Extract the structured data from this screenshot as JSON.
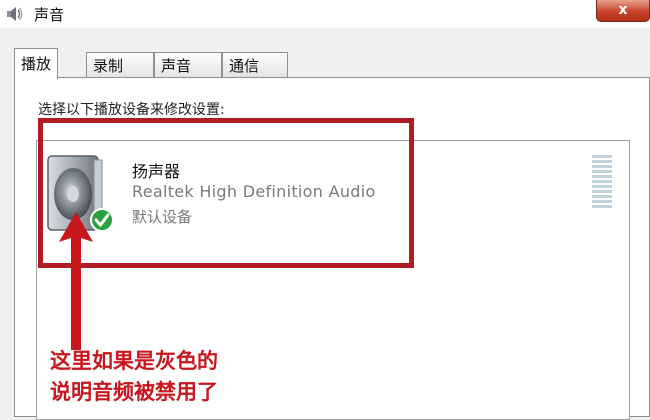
{
  "window": {
    "title": "声音",
    "close_label": "x"
  },
  "tabs": [
    {
      "label": "播放",
      "active": true
    },
    {
      "label": "录制",
      "active": false
    },
    {
      "label": "声音",
      "active": false
    },
    {
      "label": "通信",
      "active": false
    }
  ],
  "playback": {
    "instruction": "选择以下播放设备来修改设置:",
    "device": {
      "name": "扬声器",
      "driver": "Realtek High Definition Audio",
      "status": "默认设备",
      "icon": "speaker-icon",
      "badge_icon": "default-check-icon"
    }
  },
  "annotation": {
    "line1": "这里如果是灰色的",
    "line2": "说明音频被禁用了",
    "color": "#c8161d"
  },
  "colors": {
    "highlight": "#b01c22",
    "check": "#2aa043",
    "close": "#c7432a"
  }
}
